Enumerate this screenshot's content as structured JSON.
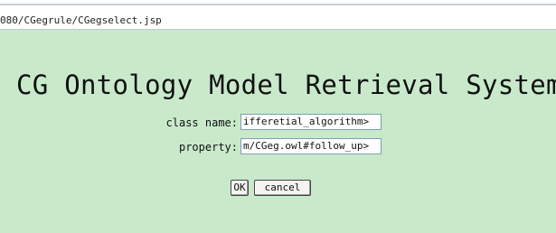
{
  "browser": {
    "address_text": "080/CGegrule/CGegselect.jsp"
  },
  "page": {
    "title": "CG Ontology Model Retrieval System",
    "form": {
      "class_name_label": "class name:",
      "class_name_value": "ifferetial_algorithm>",
      "property_label": "property:",
      "property_value": "m/CGeg.owl#follow_up>"
    },
    "buttons": {
      "ok_label": "OK",
      "cancel_label": "cancel"
    }
  },
  "colors": {
    "page_background": "#c8eacb",
    "field_border": "#7f9db9"
  }
}
